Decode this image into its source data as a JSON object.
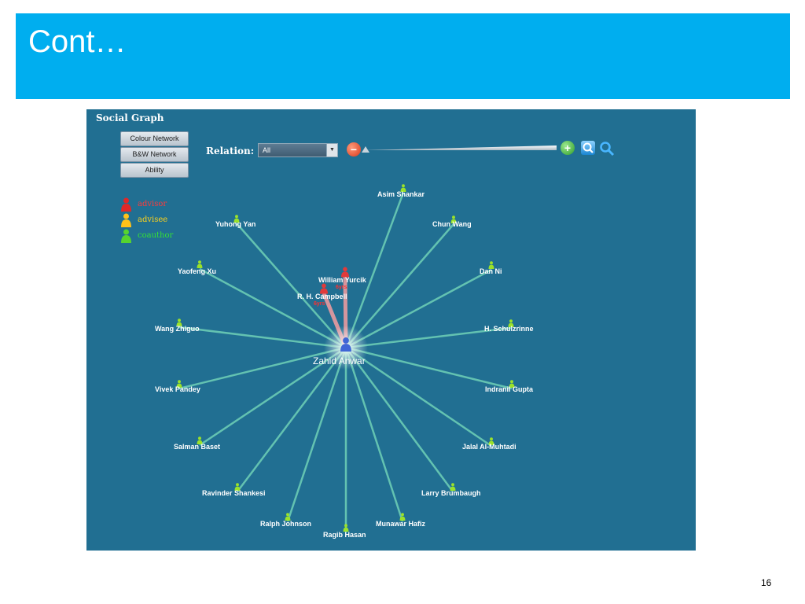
{
  "slide": {
    "title": "Cont…",
    "page_number": "16"
  },
  "panel": {
    "title": "Social Graph",
    "buttons": [
      "Colour Network",
      "B&W Network",
      "Ability"
    ],
    "relation_label": "Relation:",
    "relation_value": "All",
    "legend": [
      {
        "label": "advisor",
        "color": "#ff3b3b",
        "icon": "person-red-icon"
      },
      {
        "label": "advisee",
        "color": "#ffd31a",
        "icon": "person-yellow-icon"
      },
      {
        "label": "coauthor",
        "color": "#35e135",
        "icon": "person-green-icon"
      }
    ]
  },
  "colors": {
    "title_bar": "#00aeef",
    "panel_bg": "#216f92",
    "coauthor_edge": "#6fd1b6",
    "advisor_edge": "#e89aa0"
  },
  "graph": {
    "center": "Zahid Anwar",
    "nodes": [
      {
        "name": "Asim Shankar",
        "relation": "coauthor"
      },
      {
        "name": "Chun Wang",
        "relation": "coauthor"
      },
      {
        "name": "Dan Ni",
        "relation": "coauthor"
      },
      {
        "name": "H. Schulzrinne",
        "relation": "coauthor"
      },
      {
        "name": "Indranil Gupta",
        "relation": "coauthor"
      },
      {
        "name": "Jalal Al-Muhtadi",
        "relation": "coauthor"
      },
      {
        "name": "Larry Brumbaugh",
        "relation": "coauthor"
      },
      {
        "name": "Munawar Hafiz",
        "relation": "coauthor"
      },
      {
        "name": "Ragib Hasan",
        "relation": "coauthor"
      },
      {
        "name": "Ralph Johnson",
        "relation": "coauthor"
      },
      {
        "name": "Ravinder Shankesi",
        "relation": "coauthor"
      },
      {
        "name": "Salman Baset",
        "relation": "coauthor"
      },
      {
        "name": "Vivek Pandey",
        "relation": "coauthor"
      },
      {
        "name": "Wang Zhiguo",
        "relation": "coauthor"
      },
      {
        "name": "Yaofeng Xu",
        "relation": "coauthor"
      },
      {
        "name": "Yuhong Yan",
        "relation": "coauthor"
      },
      {
        "name": "William Yurcik",
        "relation": "advisor",
        "tag": "6yrs"
      },
      {
        "name": "R. H. Campbell",
        "relation": "advisor",
        "tag": "6yrs"
      }
    ]
  }
}
